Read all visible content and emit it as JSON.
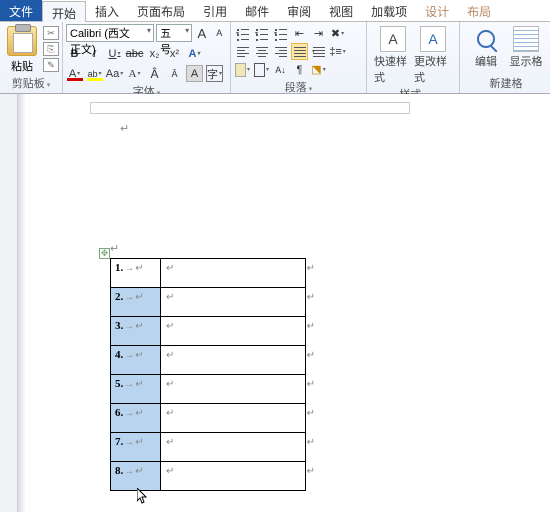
{
  "tabs": {
    "file": "文件",
    "home": "开始",
    "insert": "插入",
    "layout": "页面布局",
    "references": "引用",
    "mailings": "邮件",
    "review": "审阅",
    "view": "视图",
    "addins": "加载项",
    "design": "设计",
    "tlayout": "布局"
  },
  "clipboard": {
    "paste": "粘贴",
    "label": "剪贴板"
  },
  "font": {
    "family": "Calibri (西文正文)",
    "size": "五号",
    "label": "字体",
    "bold": "B",
    "italic": "I",
    "underline": "U",
    "strike": "abc",
    "sub": "x₂",
    "sup": "x²",
    "caseA": "A",
    "aa": "Aa",
    "growA": "A",
    "shrinkA": "A",
    "clear": "A",
    "charA": "A"
  },
  "paragraph": {
    "label": "段落",
    "sort": "A↓"
  },
  "styles": {
    "quick": "快速样式",
    "change": "更改样式",
    "label": "样式"
  },
  "editing": {
    "find": "编辑",
    "label": "新建格",
    "show": "显示格"
  },
  "table": {
    "rows": [
      {
        "n": "1."
      },
      {
        "n": "2."
      },
      {
        "n": "3."
      },
      {
        "n": "4."
      },
      {
        "n": "5."
      },
      {
        "n": "6."
      },
      {
        "n": "7."
      },
      {
        "n": "8."
      }
    ]
  },
  "marks": {
    "pilcrow": "↵",
    "arrow": "→",
    "cellend": "↵",
    "rowend": "↵"
  }
}
